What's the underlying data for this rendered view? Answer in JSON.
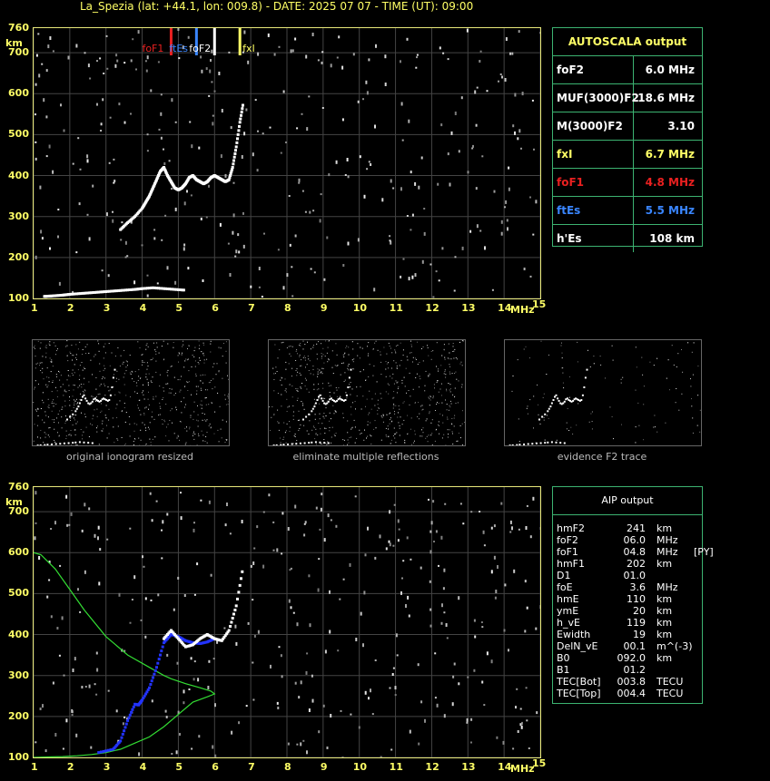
{
  "title": "La_Spezia (lat: +44.1, lon: 009.8) - DATE: 2025 07 07 - TIME (UT): 09:00",
  "colors": {
    "axis": "#ffff66",
    "frame": "#e8e87a",
    "green": "#3cb371",
    "red": "#e82020",
    "blue": "#3a86ff",
    "yellow": "#ffff66",
    "white": "#ffffff"
  },
  "chart_data": [
    {
      "type": "scatter",
      "title": "",
      "xlabel": "MHz",
      "ylabel": "km",
      "xlim": [
        1,
        15
      ],
      "ylim": [
        100,
        760
      ],
      "xticks": [
        "1",
        "2",
        "3",
        "4",
        "5",
        "6",
        "7",
        "8",
        "9",
        "10",
        "11",
        "12",
        "13",
        "14",
        "15"
      ],
      "yticks": [
        "100",
        "200",
        "300",
        "400",
        "500",
        "600",
        "700",
        "760"
      ],
      "markers": [
        {
          "label": "foF1",
          "x": 4.8,
          "color": "#e82020"
        },
        {
          "label": "ftEs",
          "x": 5.5,
          "color": "#3a86ff"
        },
        {
          "label": "foF2",
          "x": 6.0,
          "color": "#ffffff"
        },
        {
          "label": "fxI",
          "x": 6.7,
          "color": "#ffff66"
        }
      ],
      "series": [
        {
          "color": "#ffffff",
          "x": [
            3.4,
            3.6,
            3.8,
            4.0,
            4.1,
            4.2,
            4.3,
            4.4,
            4.5,
            4.6,
            4.7,
            4.8,
            4.9,
            5.0,
            5.1,
            5.2,
            5.3,
            5.4,
            5.5,
            5.6,
            5.7,
            5.8,
            5.9,
            6.0,
            6.1,
            6.2,
            6.3,
            6.4,
            6.5,
            6.6,
            6.7,
            6.8
          ],
          "y": [
            268,
            285,
            300,
            320,
            335,
            350,
            370,
            390,
            410,
            420,
            400,
            385,
            370,
            365,
            370,
            380,
            395,
            400,
            390,
            385,
            380,
            385,
            395,
            400,
            395,
            390,
            385,
            390,
            420,
            470,
            530,
            580
          ]
        },
        {
          "color": "#ffffff",
          "x": [
            1.3,
            1.5,
            1.8,
            2.0,
            2.3,
            2.6,
            2.9,
            3.2,
            3.5,
            3.8,
            4.0,
            4.3,
            4.6,
            4.9,
            5.2
          ],
          "y": [
            105,
            106,
            108,
            110,
            112,
            114,
            116,
            118,
            120,
            122,
            124,
            126,
            124,
            122,
            120
          ]
        }
      ]
    },
    {
      "type": "line",
      "title": "",
      "xlabel": "MHz",
      "ylabel": "km",
      "xlim": [
        1,
        15
      ],
      "ylim": [
        100,
        760
      ],
      "xticks": [
        "1",
        "2",
        "3",
        "4",
        "5",
        "6",
        "7",
        "8",
        "9",
        "10",
        "11",
        "12",
        "13",
        "14",
        "15"
      ],
      "yticks": [
        "100",
        "200",
        "300",
        "400",
        "500",
        "600",
        "700",
        "760"
      ],
      "series": [
        {
          "color": "#33dd33",
          "x": [
            1.0,
            1.4,
            1.8,
            2.2,
            2.6,
            3.0,
            3.4,
            3.8,
            4.2,
            4.6,
            5.0,
            5.4,
            5.8,
            6.0,
            5.9,
            5.6,
            5.2,
            4.8,
            4.6,
            4.2,
            3.6,
            3.0,
            2.4,
            2.0,
            1.6,
            1.2,
            1.0
          ],
          "y": [
            100,
            101,
            102,
            104,
            107,
            112,
            120,
            135,
            150,
            175,
            205,
            235,
            248,
            255,
            262,
            270,
            280,
            292,
            300,
            320,
            350,
            395,
            460,
            510,
            560,
            595,
            600
          ]
        },
        {
          "color": "#2233ff",
          "x": [
            2.8,
            3.2,
            3.4,
            3.6,
            3.8,
            3.9,
            4.0,
            4.2,
            4.4,
            4.6,
            4.8,
            5.0,
            5.2,
            5.4,
            5.6,
            5.8,
            6.0
          ],
          "y": [
            112,
            120,
            140,
            190,
            230,
            228,
            240,
            270,
            320,
            380,
            400,
            395,
            385,
            380,
            378,
            382,
            390
          ]
        },
        {
          "color": "#ffffff",
          "x": [
            4.6,
            4.8,
            5.0,
            5.2,
            5.4,
            5.6,
            5.8,
            6.0,
            6.2,
            6.4,
            6.6,
            6.8
          ],
          "y": [
            390,
            410,
            390,
            370,
            375,
            390,
            400,
            390,
            385,
            410,
            470,
            570
          ]
        }
      ]
    }
  ],
  "autoscala": {
    "header": "AUTOSCALA output",
    "rows": [
      {
        "name": "foF2",
        "value": "6.0 MHz",
        "color": "#ffffff"
      },
      {
        "name": "MUF(3000)F2",
        "value": "18.6 MHz",
        "color": "#ffffff"
      },
      {
        "name": "M(3000)F2",
        "value": "3.10",
        "color": "#ffffff"
      },
      {
        "name": "fxI",
        "value": "6.7 MHz",
        "color": "#ffff66"
      },
      {
        "name": "foF1",
        "value": "4.8 MHz",
        "color": "#e82020"
      },
      {
        "name": "ftEs",
        "value": "5.5 MHz",
        "color": "#3a86ff"
      },
      {
        "name": "h'Es",
        "value": "108     km",
        "color": "#ffffff"
      }
    ]
  },
  "thumbnails": [
    {
      "caption": "original ionogram resized"
    },
    {
      "caption": "eliminate multiple reflections"
    },
    {
      "caption": "evidence F2 trace"
    }
  ],
  "aip": {
    "header": "AIP output",
    "rows": [
      [
        "hmF2",
        "241",
        "km"
      ],
      [
        "foF2",
        "06.0",
        "MHz"
      ],
      [
        "foF1",
        "04.8",
        "MHz     [PY]"
      ],
      [
        "hmF1",
        "202",
        "km"
      ],
      [
        "D1",
        "01.0",
        ""
      ],
      [
        "foE",
        "3.6",
        "MHz"
      ],
      [
        "hmE",
        "110",
        "km"
      ],
      [
        "ymE",
        "20",
        "km"
      ],
      [
        "h_vE",
        "119",
        "km"
      ],
      [
        "Ewidth",
        "19",
        "km"
      ],
      [
        "DelN_vE",
        "00.1",
        "m^(-3)"
      ],
      [
        "B0",
        "092.0",
        "km"
      ],
      [
        "B1",
        "01.2",
        ""
      ],
      [
        "TEC[Bot]",
        "003.8",
        "TECU"
      ],
      [
        "TEC[Top]",
        "004.4",
        "TECU"
      ]
    ]
  }
}
